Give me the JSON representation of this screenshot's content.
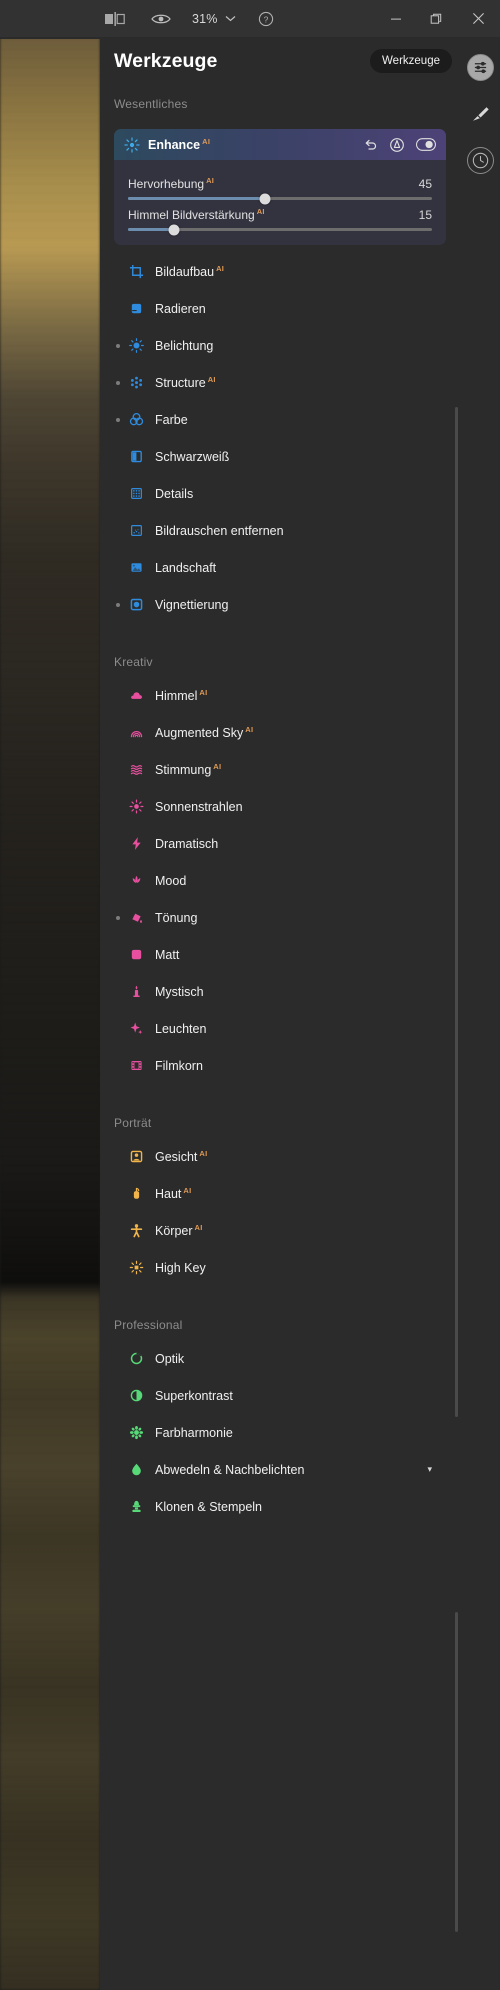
{
  "titlebar": {
    "zoom_level": "31%",
    "icons": {
      "compare": "compare-split-icon",
      "eye": "eye-icon",
      "chevron": "chevron-down-icon",
      "help": "help-circle-icon",
      "minimize": "window-minimize-icon",
      "maximize": "window-restore-icon",
      "close": "window-close-icon"
    }
  },
  "panel": {
    "title": "Werkzeuge",
    "tooltip_chip": "Werkzeuge",
    "sliders_icon": "sliders-icon"
  },
  "rail": {
    "items": [
      {
        "name": "edit-sliders-icon",
        "active": true
      },
      {
        "name": "brush-masking-icon",
        "active": false
      },
      {
        "name": "history-clock-icon",
        "active": false
      }
    ]
  },
  "enhance": {
    "name": "Enhance",
    "ai_badge": "AI",
    "actions": [
      "reset-icon",
      "mask-icon",
      "toggle-visibility-icon"
    ],
    "sliders": [
      {
        "label": "Hervorhebung",
        "ai": "AI",
        "value": "45",
        "percent": 45
      },
      {
        "label": "Himmel Bildverstärkung",
        "ai": "AI",
        "value": "15",
        "percent": 15
      }
    ]
  },
  "sections": [
    {
      "label": "Wesentliches",
      "accent": "#2f8bdd",
      "tools": [
        {
          "label": "Bildaufbau",
          "ai": "AI",
          "icon": "crop-icon",
          "modified": false
        },
        {
          "label": "Radieren",
          "ai": "",
          "icon": "eraser-icon",
          "modified": false
        },
        {
          "label": "Belichtung",
          "ai": "",
          "icon": "sun-exposure-icon",
          "modified": true
        },
        {
          "label": "Structure",
          "ai": "AI",
          "icon": "structure-dots-icon",
          "modified": true
        },
        {
          "label": "Farbe",
          "ai": "",
          "icon": "color-circles-icon",
          "modified": true
        },
        {
          "label": "Schwarzweiß",
          "ai": "",
          "icon": "black-white-icon",
          "modified": false
        },
        {
          "label": "Details",
          "ai": "",
          "icon": "details-grid-icon",
          "modified": false
        },
        {
          "label": "Bildrauschen entfernen",
          "ai": "",
          "icon": "denoise-icon",
          "modified": false
        },
        {
          "label": "Landschaft",
          "ai": "",
          "icon": "landscape-icon",
          "modified": false
        },
        {
          "label": "Vignettierung",
          "ai": "",
          "icon": "vignette-icon",
          "modified": true
        }
      ]
    },
    {
      "label": "Kreativ",
      "accent": "#e8509f",
      "tools": [
        {
          "label": "Himmel",
          "ai": "AI",
          "icon": "cloud-icon",
          "modified": false
        },
        {
          "label": "Augmented Sky",
          "ai": "AI",
          "icon": "rainbow-icon",
          "modified": false
        },
        {
          "label": "Stimmung",
          "ai": "AI",
          "icon": "waves-icon",
          "modified": false
        },
        {
          "label": "Sonnenstrahlen",
          "ai": "",
          "icon": "sunrays-icon",
          "modified": false
        },
        {
          "label": "Dramatisch",
          "ai": "",
          "icon": "bolt-icon",
          "modified": false
        },
        {
          "label": "Mood",
          "ai": "",
          "icon": "lotus-icon",
          "modified": false
        },
        {
          "label": "Tönung",
          "ai": "",
          "icon": "paint-bucket-icon",
          "modified": true
        },
        {
          "label": "Matt",
          "ai": "",
          "icon": "matte-square-icon",
          "modified": false
        },
        {
          "label": "Mystisch",
          "ai": "",
          "icon": "candle-icon",
          "modified": false
        },
        {
          "label": "Leuchten",
          "ai": "",
          "icon": "sparkle-icon",
          "modified": false
        },
        {
          "label": "Filmkorn",
          "ai": "",
          "icon": "film-icon",
          "modified": false
        }
      ]
    },
    {
      "label": "Porträt",
      "accent": "#f0b44a",
      "tools": [
        {
          "label": "Gesicht",
          "ai": "AI",
          "icon": "face-portrait-icon",
          "modified": false
        },
        {
          "label": "Haut",
          "ai": "AI",
          "icon": "skin-icon",
          "modified": false
        },
        {
          "label": "Körper",
          "ai": "AI",
          "icon": "body-icon",
          "modified": false
        },
        {
          "label": "High Key",
          "ai": "",
          "icon": "highkey-icon",
          "modified": false
        }
      ]
    },
    {
      "label": "Professional",
      "accent": "#58d978",
      "tools": [
        {
          "label": "Optik",
          "ai": "",
          "icon": "optics-icon",
          "modified": false
        },
        {
          "label": "Superkontrast",
          "ai": "",
          "icon": "contrast-icon",
          "modified": false
        },
        {
          "label": "Farbharmonie",
          "ai": "",
          "icon": "color-harmony-icon",
          "modified": false
        },
        {
          "label": "Abwedeln & Nachbelichten",
          "ai": "",
          "icon": "dodge-burn-icon",
          "modified": false,
          "caret": "▾"
        },
        {
          "label": "Klonen & Stempeln",
          "ai": "",
          "icon": "clone-stamp-icon",
          "modified": false
        }
      ]
    }
  ]
}
